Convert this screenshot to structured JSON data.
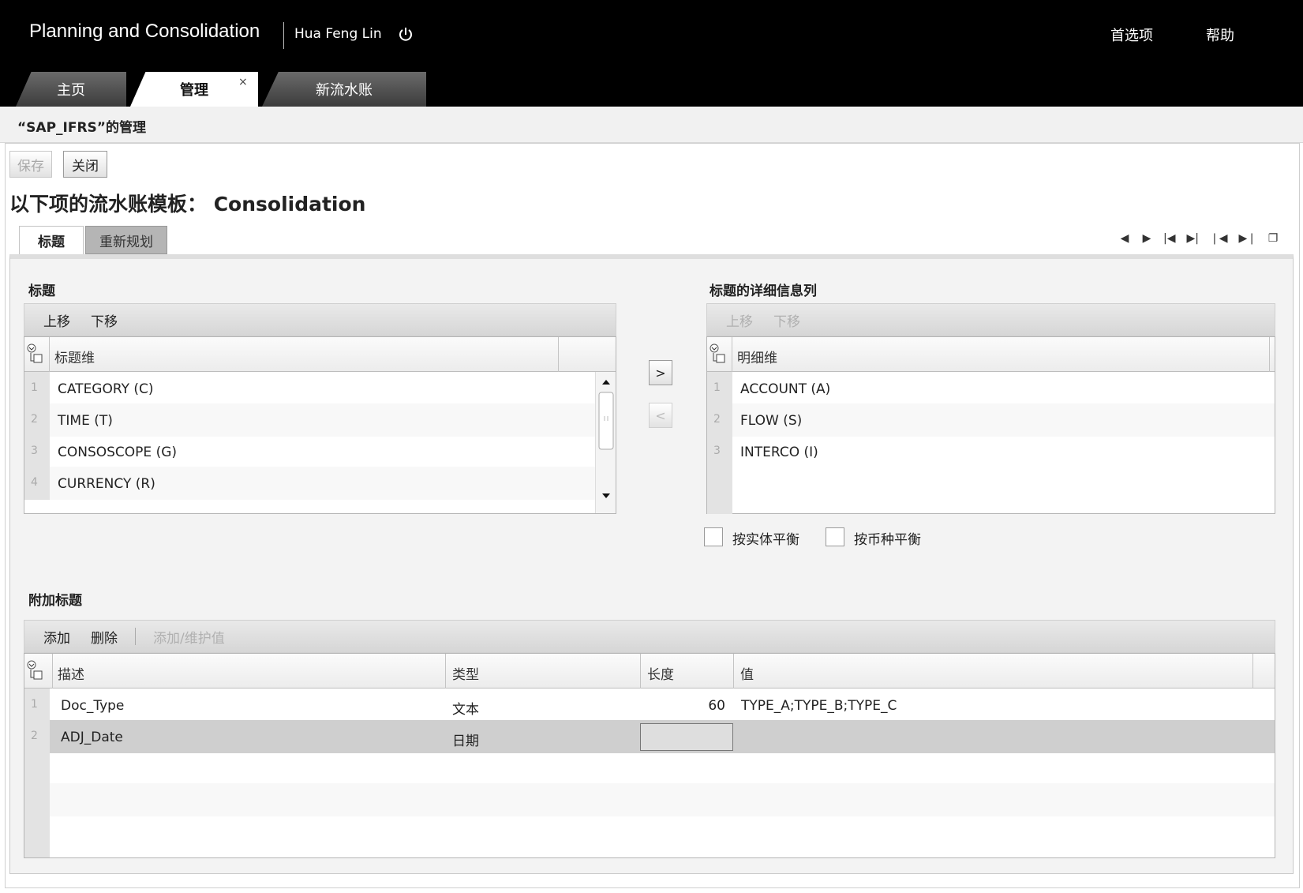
{
  "app": {
    "title": "Planning and Consolidation",
    "user": "Hua Feng Lin",
    "preferences": "首选项",
    "help": "帮助"
  },
  "top_tabs": {
    "home": "主页",
    "manage": "管理",
    "manage_close": "×",
    "new_journal": "新流水账"
  },
  "page": {
    "subtitle": "“SAP_IFRS”的管理",
    "save": "保存",
    "close": "关闭",
    "heading": "以下项的流水账模板： Consolidation"
  },
  "sub_tabs": {
    "header": "标题",
    "reclass": "重新规划"
  },
  "nav_icons": [
    "arrow-left",
    "arrow-right",
    "first",
    "last",
    "first-page",
    "last-page",
    "window"
  ],
  "header_section": {
    "title": "标题",
    "move_up": "上移",
    "move_down": "下移",
    "column": "标题维",
    "rows": [
      {
        "n": "1",
        "v": "CATEGORY (C)"
      },
      {
        "n": "2",
        "v": "TIME (T)"
      },
      {
        "n": "3",
        "v": "CONSOSCOPE (G)"
      },
      {
        "n": "4",
        "v": "CURRENCY (R)"
      }
    ]
  },
  "transfer": {
    "right": ">",
    "left": "<"
  },
  "detail_section": {
    "title": "标题的详细信息列",
    "move_up": "上移",
    "move_down": "下移",
    "column": "明细维",
    "rows": [
      {
        "n": "1",
        "v": "ACCOUNT (A)"
      },
      {
        "n": "2",
        "v": "FLOW (S)"
      },
      {
        "n": "3",
        "v": "INTERCO (I)"
      }
    ],
    "balance_entity": "按实体平衡",
    "balance_currency": "按币种平衡"
  },
  "additional_section": {
    "title": "附加标题",
    "add": "添加",
    "delete": "删除",
    "add_maintain": "添加/维护值",
    "columns": {
      "description": "描述",
      "type": "类型",
      "length": "长度",
      "value": "值"
    },
    "rows": [
      {
        "n": "1",
        "description": "Doc_Type",
        "type": "文本",
        "length": "60",
        "value": "TYPE_A;TYPE_B;TYPE_C"
      },
      {
        "n": "2",
        "description": "ADJ_Date",
        "type": "日期",
        "length": "",
        "value": ""
      }
    ]
  }
}
